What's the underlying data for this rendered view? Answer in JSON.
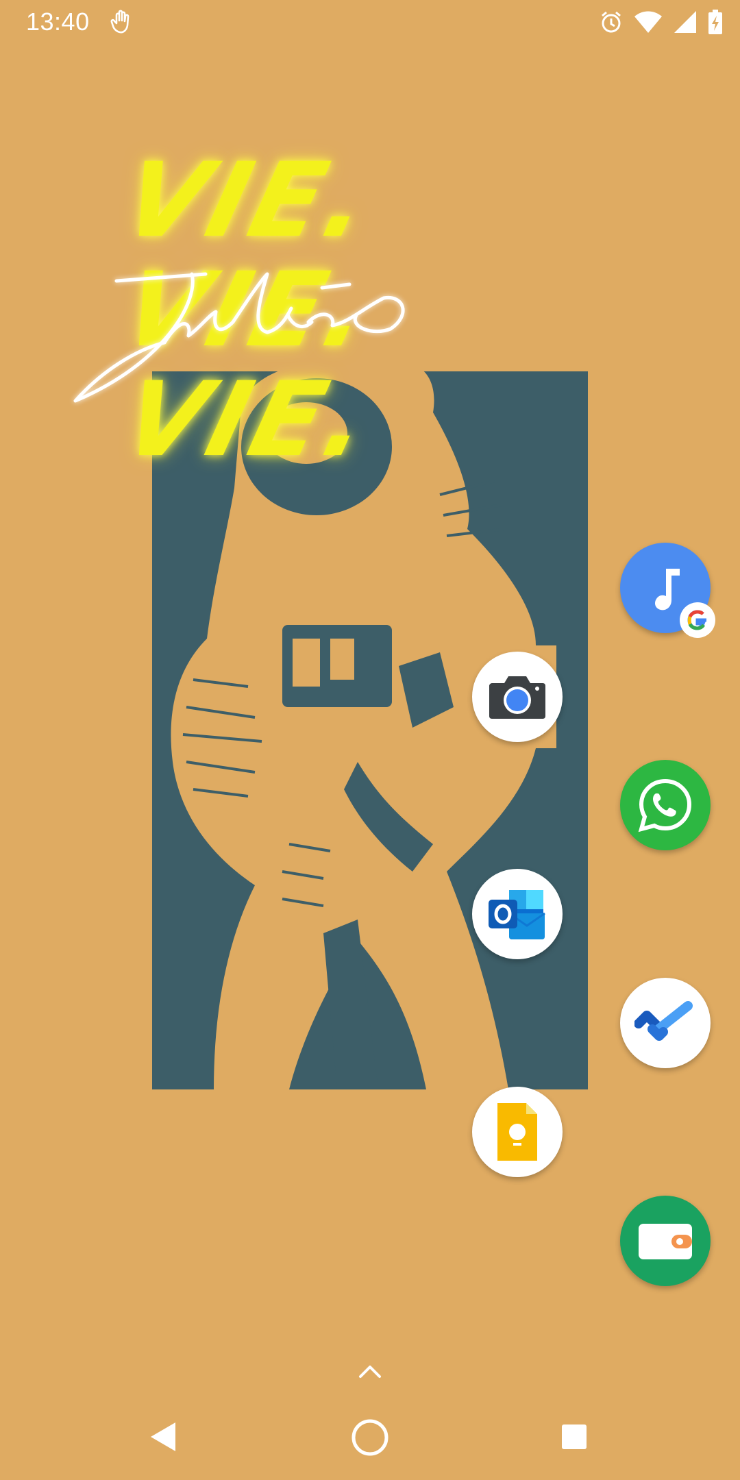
{
  "status_bar": {
    "time": "13:40",
    "left_icons": [
      "gesture-hand-icon"
    ],
    "right_icons": [
      "alarm-icon",
      "wifi-icon",
      "cell-signal-icon",
      "battery-charging-icon"
    ]
  },
  "wallpaper": {
    "neon_words": [
      "VIE.",
      "VIE.",
      "VIE."
    ],
    "script_text": "julie",
    "colors": {
      "background": "#DFAB62",
      "panel": "#3D5E68",
      "neon": "#F3F11C"
    }
  },
  "apps": [
    {
      "name": "YouTube Music",
      "icon": "music-note-icon"
    },
    {
      "name": "Camera",
      "icon": "camera-icon"
    },
    {
      "name": "WhatsApp",
      "icon": "whatsapp-icon"
    },
    {
      "name": "Outlook",
      "icon": "outlook-icon"
    },
    {
      "name": "Microsoft To Do",
      "icon": "checkmark-icon"
    },
    {
      "name": "Google Keep",
      "icon": "keep-lightbulb-icon"
    },
    {
      "name": "Google Pay",
      "icon": "wallet-icon"
    }
  ],
  "nav_bar": {
    "buttons": [
      "back-icon",
      "home-icon",
      "recents-icon"
    ]
  },
  "app_drawer_hint": "chevron-up-icon"
}
